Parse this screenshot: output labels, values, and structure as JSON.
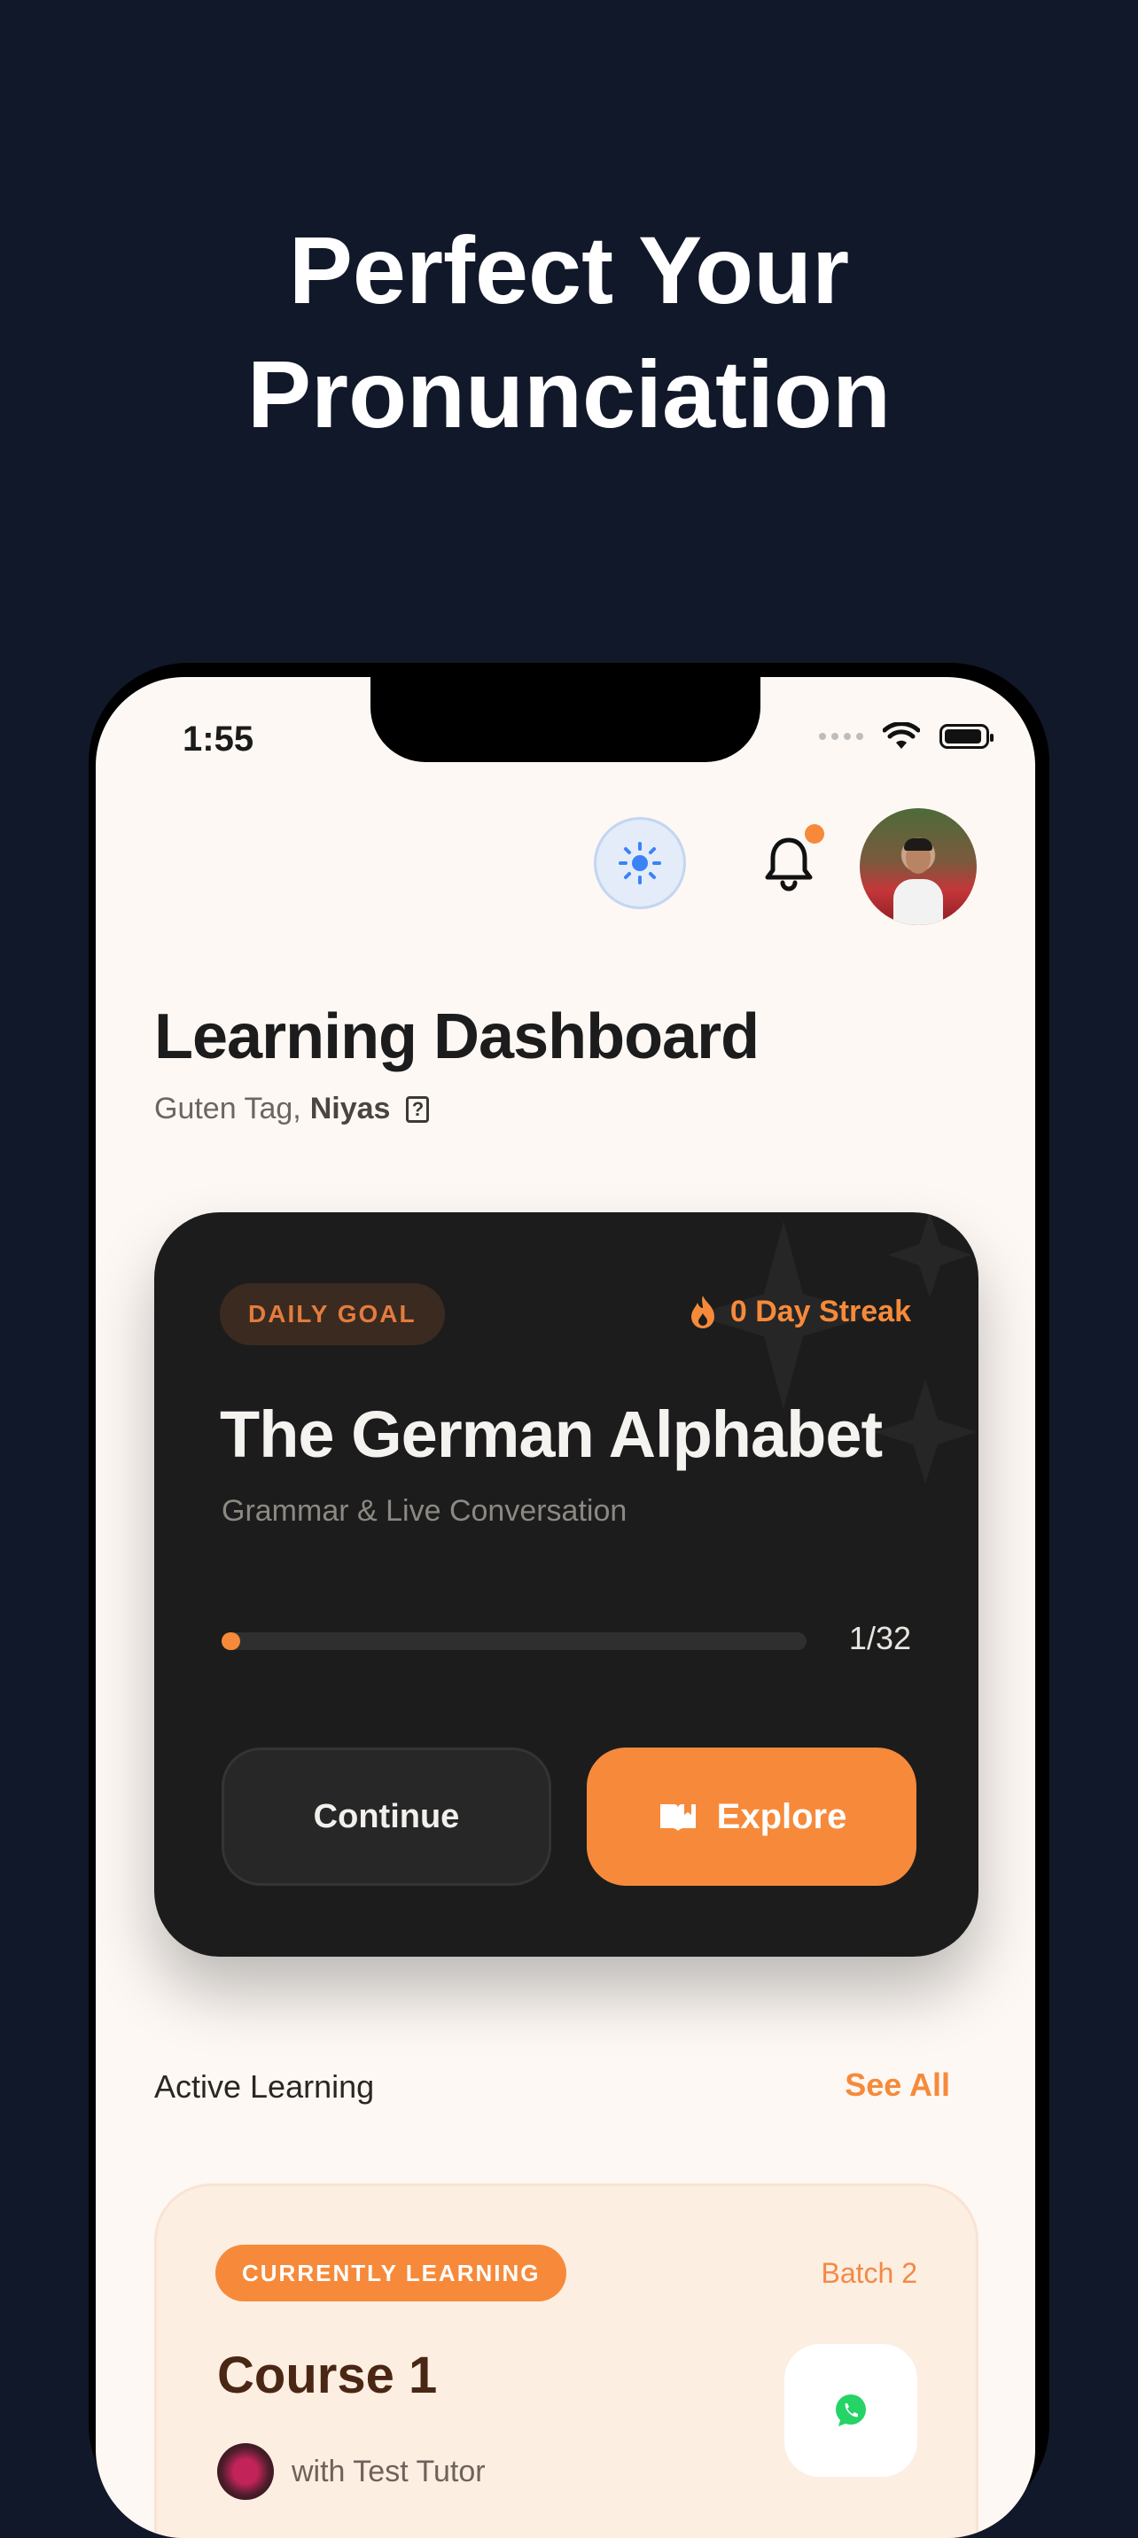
{
  "hero": {
    "line1": "Perfect Your",
    "line2": "Pronunciation"
  },
  "status_bar": {
    "time": "1:55"
  },
  "header": {
    "theme_icon": "sun-icon",
    "notification_icon": "bell-icon",
    "avatar_icon": "user-avatar"
  },
  "dashboard": {
    "title": "Learning Dashboard",
    "greeting_prefix": "Guten Tag,",
    "user_name": "Niyas",
    "help_glyph": "?"
  },
  "daily_goal": {
    "badge": "DAILY GOAL",
    "streak": "0 Day Streak",
    "lesson_title": "The German Alphabet",
    "lesson_subtitle": "Grammar & Live Conversation",
    "progress_current": 1,
    "progress_total": 32,
    "progress_label": "1/32",
    "continue_label": "Continue",
    "explore_label": "Explore"
  },
  "active_learning": {
    "title": "Active Learning",
    "see_all": "See All",
    "course": {
      "badge": "CURRENTLY LEARNING",
      "batch": "Batch 2",
      "title": "Course 1",
      "tutor": "with Test Tutor"
    }
  },
  "colors": {
    "accent": "#f68a3a",
    "background": "#11182a",
    "card_dark": "#1c1c1c",
    "screen_bg": "#fdf8f4"
  }
}
